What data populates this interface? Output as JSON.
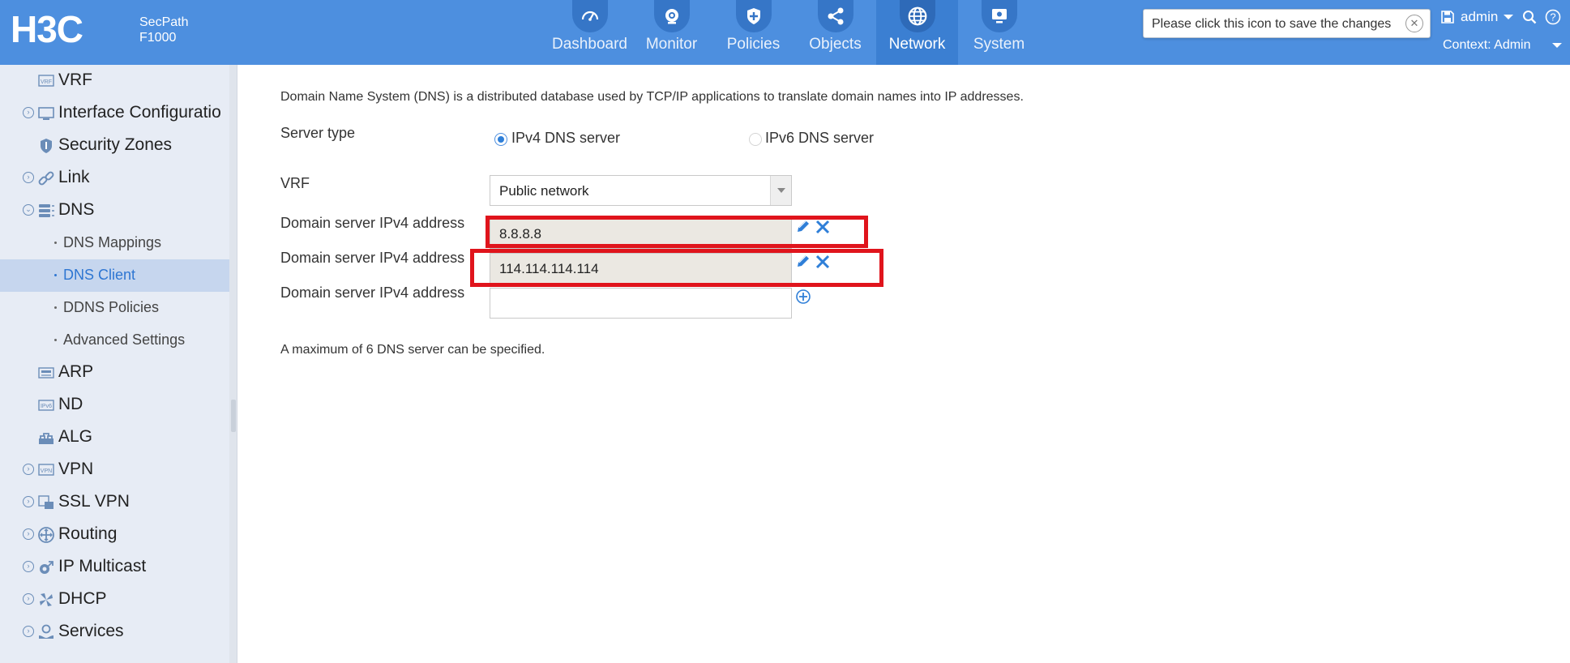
{
  "header": {
    "brand": "H3C",
    "product_line1": "SecPath",
    "product_line2": "F1000",
    "nav": [
      {
        "label": "Dashboard",
        "icon": "dashboard-icon",
        "active": false
      },
      {
        "label": "Monitor",
        "icon": "monitor-icon",
        "active": false
      },
      {
        "label": "Policies",
        "icon": "policies-icon",
        "active": false
      },
      {
        "label": "Objects",
        "icon": "objects-icon",
        "active": false
      },
      {
        "label": "Network",
        "icon": "network-icon",
        "active": true
      },
      {
        "label": "System",
        "icon": "system-icon",
        "active": false
      }
    ],
    "tooltip": "Please click this icon to save the changes",
    "user": "admin",
    "context": "Context: Admin"
  },
  "sidebar": {
    "items": [
      {
        "label": "VRF",
        "icon": "vrf-icon",
        "expandable": false,
        "sub": false,
        "active": false
      },
      {
        "label": "Interface Configuratio",
        "icon": "interface-icon",
        "expandable": true,
        "sub": false,
        "active": false
      },
      {
        "label": "Security Zones",
        "icon": "shield-icon",
        "expandable": false,
        "sub": false,
        "active": false
      },
      {
        "label": "Link",
        "icon": "link-icon",
        "expandable": true,
        "sub": false,
        "active": false
      },
      {
        "label": "DNS",
        "icon": "dns-icon",
        "expandable": true,
        "sub": false,
        "active": false
      },
      {
        "label": "DNS Mappings",
        "icon": "",
        "expandable": false,
        "sub": true,
        "active": false
      },
      {
        "label": "DNS Client",
        "icon": "",
        "expandable": false,
        "sub": true,
        "active": true
      },
      {
        "label": "DDNS Policies",
        "icon": "",
        "expandable": false,
        "sub": true,
        "active": false
      },
      {
        "label": "Advanced Settings",
        "icon": "",
        "expandable": false,
        "sub": true,
        "active": false
      },
      {
        "label": "ARP",
        "icon": "arp-icon",
        "expandable": false,
        "sub": false,
        "active": false
      },
      {
        "label": "ND",
        "icon": "nd-icon",
        "expandable": false,
        "sub": false,
        "active": false
      },
      {
        "label": "ALG",
        "icon": "alg-icon",
        "expandable": false,
        "sub": false,
        "active": false
      },
      {
        "label": "VPN",
        "icon": "vpn-icon",
        "expandable": true,
        "sub": false,
        "active": false
      },
      {
        "label": "SSL VPN",
        "icon": "ssl-vpn-icon",
        "expandable": true,
        "sub": false,
        "active": false
      },
      {
        "label": "Routing",
        "icon": "routing-icon",
        "expandable": true,
        "sub": false,
        "active": false
      },
      {
        "label": "IP Multicast",
        "icon": "multicast-icon",
        "expandable": true,
        "sub": false,
        "active": false
      },
      {
        "label": "DHCP",
        "icon": "dhcp-icon",
        "expandable": true,
        "sub": false,
        "active": false
      },
      {
        "label": "Services",
        "icon": "services-icon",
        "expandable": true,
        "sub": false,
        "active": false
      }
    ]
  },
  "main": {
    "description": "Domain Name System (DNS) is a distributed database used by TCP/IP applications to translate domain names into IP addresses.",
    "server_type_label": "Server type",
    "server_type_options": [
      {
        "label": "IPv4 DNS server",
        "selected": true,
        "enabled": true
      },
      {
        "label": "IPv6 DNS server",
        "selected": false,
        "enabled": false
      }
    ],
    "vrf_label": "VRF",
    "vrf_value": "Public network",
    "servers": [
      {
        "label": "Domain server IPv4 address",
        "value": "8.8.8.8"
      },
      {
        "label": "Domain server IPv4 address",
        "value": "114.114.114.114"
      },
      {
        "label": "Domain server IPv4 address",
        "value": ""
      }
    ],
    "note": "A maximum of 6 DNS server can be specified."
  },
  "colors": {
    "header_bg": "#4d8fdf",
    "nav_active_bg": "#3b7fd2",
    "sidebar_bg": "#e7ecf5",
    "sidebar_active_bg": "#c6d6ee",
    "sidebar_active_text": "#2e76d2",
    "highlight_box": "#e0141c"
  }
}
